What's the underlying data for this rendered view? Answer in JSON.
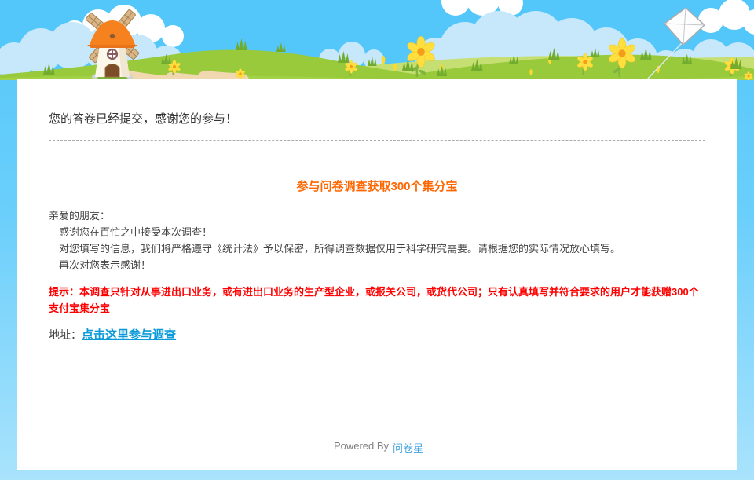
{
  "colors": {
    "sky": "#54C7FA",
    "page_bottom": "#A9E3FC",
    "cloud_light": "#C6E8FA",
    "cloud_white": "#FFFFFF",
    "hill_main": "#98CA3B",
    "hill_far": "#C6DF72",
    "hill_front": "#A4D246",
    "windmill_roof": "#F5821F",
    "trail": "#F2D8B0",
    "promo_title": "#FF6600",
    "tip_red": "#FF0000",
    "address_link": "#0A9AD8",
    "footer_link": "#44A3DC",
    "text_dark": "#333333",
    "text_body": "#444444",
    "footer_text": "#808080"
  },
  "header_art": {
    "elements": [
      "sky",
      "white-clouds",
      "blue-clouds",
      "grass-hills",
      "windmill",
      "trail-path",
      "flowers",
      "grass-tufts",
      "kite"
    ]
  },
  "content": {
    "submitted_message": "您的答卷已经提交，感谢您的参与！",
    "promo_title": "参与问卷调查获取300个集分宝",
    "greeting_lines": [
      "亲爱的朋友：",
      "感谢您在百忙之中接受本次调查！",
      "对您填写的信息，我们将严格遵守《统计法》予以保密，所得调查数据仅用于科学研究需要。请根据您的实际情况放心填写。",
      "再次对您表示感谢！"
    ],
    "tip_text": "提示：本调查只针对从事进出口业务，或有进出口业务的生产型企业，或报关公司，或货代公司；只有认真填写并符合要求的用户才能获赠300个支付宝集分宝",
    "address_label": "地址：",
    "address_link_text": "点击这里参与调查"
  },
  "footer": {
    "powered_by_label": "Powered By",
    "brand_link_text": "问卷星"
  }
}
